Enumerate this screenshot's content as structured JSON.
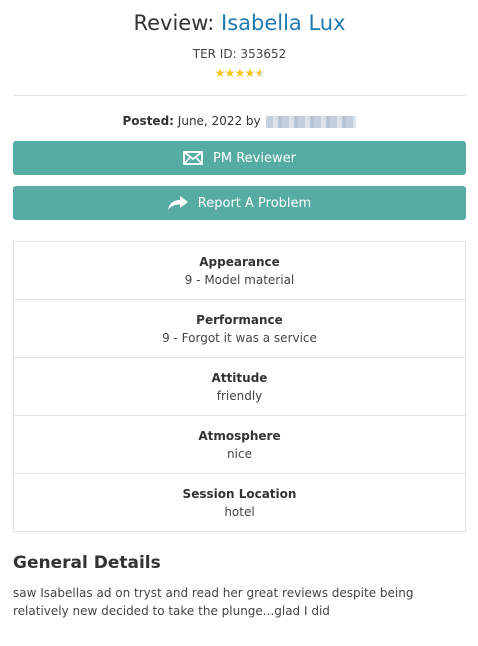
{
  "header": {
    "title_prefix": "Review:",
    "provider_name": "Isabella Lux",
    "ter_id": "TER ID: 353652",
    "rating_stars": 4.5
  },
  "posted": {
    "label": "Posted:",
    "text": "June, 2022 by"
  },
  "buttons": {
    "pm_label": "PM Reviewer",
    "report_label": "Report A Problem",
    "color": "#56aba3"
  },
  "ratings": [
    {
      "label": "Appearance",
      "value": "9 - Model material"
    },
    {
      "label": "Performance",
      "value": "9 - Forgot it was a service"
    },
    {
      "label": "Attitude",
      "value": "friendly"
    },
    {
      "label": "Atmosphere",
      "value": "nice"
    },
    {
      "label": "Session Location",
      "value": "hotel"
    }
  ],
  "general_details": {
    "title": "General Details",
    "text": "saw Isabellas ad on tryst and read her great reviews despite being relatively new decided to take the plunge...glad I did"
  },
  "colors": {
    "link": "#1f7ab0",
    "star": "#f4c31b"
  }
}
